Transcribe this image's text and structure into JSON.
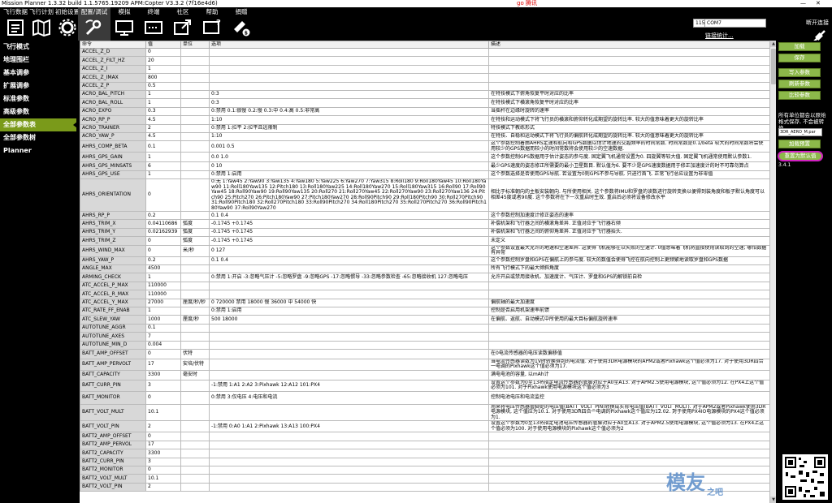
{
  "title": "Mission Planner 1.3.32 build 1.1.5765.19209 APM:Copter V3.3.2 (7f16e4d6)",
  "titlebar_ad": "go 腾讯",
  "window_minimize": "—",
  "window_close": "✕",
  "menu": [
    {
      "label": "飞行数据",
      "icon": "flight-data-icon"
    },
    {
      "label": "飞行计划",
      "icon": "flight-plan-icon"
    },
    {
      "label": "初始设置",
      "icon": "initial-setup-icon"
    },
    {
      "label": "配置/调试",
      "icon": "config-tuning-icon"
    },
    {
      "label": "模拟",
      "icon": "simulation-icon"
    },
    {
      "label": "终端",
      "icon": "terminal-icon"
    },
    {
      "label": "社区",
      "icon": "community-icon"
    },
    {
      "label": "帮助",
      "icon": "help-icon"
    },
    {
      "label": "捐赠",
      "icon": "donate-icon"
    }
  ],
  "connection": {
    "port": "COM7",
    "baud": "115200",
    "link_stats": "链接统计...",
    "disconnect": "断开连接"
  },
  "sidebar": [
    "飞行模式",
    "地理围栏",
    "基本调参",
    "扩展调参",
    "标准参数",
    "高级参数",
    "全部参数表",
    "全部参数树",
    "Planner"
  ],
  "sidebar_active": 6,
  "columns": [
    "命令",
    "值",
    "单位",
    "选项",
    "描述"
  ],
  "rows": [
    {
      "n": "ACCEL_Z_D",
      "v": "0",
      "u": "",
      "o": "",
      "d": ""
    },
    {
      "n": "ACCEL_Z_FILT_HZ",
      "v": "20",
      "u": "",
      "o": "",
      "d": ""
    },
    {
      "n": "ACCEL_Z_I",
      "v": "1",
      "u": "",
      "o": "",
      "d": ""
    },
    {
      "n": "ACCEL_Z_IMAX",
      "v": "800",
      "u": "",
      "o": "",
      "d": ""
    },
    {
      "n": "ACCEL_Z_P",
      "v": "0.5",
      "u": "",
      "o": "",
      "d": ""
    },
    {
      "n": "ACRO_BAL_PITCH",
      "v": "1",
      "u": "",
      "o": "0:3",
      "d": "在特技模式下俯角恢复平时对应的比率"
    },
    {
      "n": "ACRO_BAL_ROLL",
      "v": "1",
      "u": "",
      "o": "0:3",
      "d": "在特技模式下横滚角恢复平时对应的比率"
    },
    {
      "n": "ACRO_EXPO",
      "v": "0.3",
      "u": "",
      "o": "0:禁用 0.1:很慢 0.2:慢 0.3:中 0.4:高 0.5:非常高",
      "d": "当摇杆在边缘时旋转的速率"
    },
    {
      "n": "ACRO_RP_P",
      "v": "4.5",
      "u": "",
      "o": "1:10",
      "d": "在特技和运动模式下将飞行员的横滚和俯仰转化成期望的旋转比率. 较大的值意味着更大的旋转比率"
    },
    {
      "n": "ACRO_TRAINER",
      "v": "2",
      "u": "",
      "o": "0:禁用 1:拉平 2:拉平且远限制",
      "d": "特技模式下教练形式"
    },
    {
      "n": "ACRO_YAW_P",
      "v": "4.5",
      "u": "",
      "o": "1:10",
      "d": "在特技、自稳和运动模式下将飞行员的偏航转化成期望的旋转比率. 较大的值意味着更大的旋转比率"
    },
    {
      "n": "AHRS_COMP_BETA",
      "v": "0.1",
      "u": "",
      "o": "0.001 0.5",
      "d": "这个参数控制着由AHRS定速和航向和GPS数据以估计地速的交越频率的时间常数. 时间常数是0.1/beta 较大的时间常数将会使用较少的GPS数据而较小的时间常数将会使用较少的空速数据."
    },
    {
      "n": "AHRS_GPS_GAIN",
      "v": "1",
      "u": "",
      "o": "0.0 1.0",
      "d": "这个参数控制GPS数据用于估计姿态的参与度. 固定翼飞机通常设置为0. 四旋翼等较大值. 固定翼飞机通常使用默认参数1."
    },
    {
      "n": "AHRS_GPS_MINSATS",
      "v": "6",
      "u": "",
      "o": "0 10",
      "d": "最少GPS速度的姿态修正所需要的最小卫星数目. 默认值为6. 要不少是GPS速度数据用于修正加速度计的时不可靠勿算点"
    },
    {
      "n": "AHRS_GPS_USE",
      "v": "1",
      "u": "",
      "o": "0:禁用 1:启用",
      "d": "这个参数选择是否使用GPS导航. 若设置为0则GPS不参与导航. 只进行首飞. 正常飞行总应设置为非零值"
    },
    {
      "n": "AHRS_ORIENTATION",
      "v": "0",
      "u": "",
      "o": "0:无 1:Yaw45 2:Yaw90 3:Yaw135 4:Yaw180 5:Yaw225 6:Yaw270 7:Yaw315 8:Roll180 9:Roll180Yaw45 10:Roll180Yaw90 11:Roll180Yaw135 12:Pitch180 13:Roll180Yaw225 14:Roll180Yaw270 15:Roll180Yaw315 16:Roll90 17:Roll90Yaw45 18:Roll90Yaw90 19:Roll90Yaw135 20:Roll270 21:Roll270Yaw45 22:Roll270Yaw90 23:Roll270Yaw136 24:Pitch90 25:Pitch270 26:Pitch180Yaw90 27:Pitch180Yaw270 28:Roll90Pitch90 29:Roll180Pitch90 30:Roll270Pitch90 31:Roll90Pitch180 32:Roll270Pitch180 33:Roll90Pitch270 34:Roll180Pitch270 35:Roll270Pitch270 36:Roll90Pitch180Yaw90 37:Roll90Yaw270",
      "d": "相比于标准朝向的主板安装朝向. 与所使用相关. 这个参数将IMU和罗盘的读数进行旋转变换以便得到装角度和板子默认角度可以相差45度或者90度. 这个参数将在下一次重启时生效. 重启后必须将设备修改水平"
    },
    {
      "n": "AHRS_RP_P",
      "v": "0.2",
      "u": "",
      "o": "0.1 0.4",
      "d": "这个参数控制加速度计修正姿态的速率"
    },
    {
      "n": "AHRS_TRIM_X",
      "v": "0.04110686",
      "u": "弧度",
      "o": "-0.1745 +0.1745",
      "d": "补偿机架和飞行器之间的横滚角差异. 正值对应于飞行器右倾"
    },
    {
      "n": "AHRS_TRIM_Y",
      "v": "0.02162939",
      "u": "弧度",
      "o": "-0.1745 +0.1745",
      "d": "补偿机架和飞行器之间的俯仰角差异. 正值对应于飞行器抬头."
    },
    {
      "n": "AHRS_TRIM_Z",
      "v": "0",
      "u": "弧度",
      "o": "-0.1745 +0.1745",
      "d": "未定义"
    },
    {
      "n": "AHRS_WIND_MAX",
      "v": "0",
      "u": "米/秒",
      "o": "0 127",
      "d": "这个参数设置最大允许的地速和空速差异. 这使得飞机能够在以失败的空速计. 0值意味着飞机将直接使用读取到的空速; 哪怕数据有异常"
    },
    {
      "n": "AHRS_YAW_P",
      "v": "0.2",
      "u": "",
      "o": "0.1 0.4",
      "d": "这个参数控制罗盘和GPS在偏航上的参与度. 较大的数值会使得飞控在航向控制上更频繁地读取罗盘和GPS数据"
    },
    {
      "n": "ANGLE_MAX",
      "v": "4500",
      "u": "",
      "o": "",
      "d": "所有飞行模式下的最大倾斜角度"
    },
    {
      "n": "ARMING_CHECK",
      "v": "1",
      "u": "",
      "o": "0:禁用 1:开启 -3:忽略气压计 -5:忽略罗盘 -9:忽略GPS -17:忽略惯导 -33:忽略参数检查 -65:忽略接收机 127:忽略电压",
      "d": "允许开启或禁用接收机、加速度计、气压计、罗盘和GPS的解锁前自检"
    },
    {
      "n": "ATC_ACCEL_P_MAX",
      "v": "110000",
      "u": "",
      "o": "",
      "d": ""
    },
    {
      "n": "ATC_ACCEL_R_MAX",
      "v": "110000",
      "u": "",
      "o": "",
      "d": ""
    },
    {
      "n": "ATC_ACCEL_Y_MAX",
      "v": "27000",
      "u": "厘度/秒/秒",
      "o": "0 720000 禁用 18000 慢 36000 中 54000 快",
      "d": "偏航轴的最大加速度"
    },
    {
      "n": "ATC_RATE_FF_ENAB",
      "v": "1",
      "u": "",
      "o": "0:禁用 1:启用",
      "d": "控制是否启用机架速率前馈"
    },
    {
      "n": "ATC_SLEW_YAW",
      "v": "1000",
      "u": "厘度/秒",
      "o": "500 18000",
      "d": "在偏航、返航、自动模式中所使用的最大目标偏航旋转速率"
    },
    {
      "n": "AUTOTUNE_AGGR",
      "v": "0.1",
      "u": "",
      "o": "",
      "d": ""
    },
    {
      "n": "AUTOTUNE_AXES",
      "v": "7",
      "u": "",
      "o": "",
      "d": ""
    },
    {
      "n": "AUTOTUNE_MIN_D",
      "v": "0.004",
      "u": "",
      "o": "",
      "d": ""
    },
    {
      "n": "BATT_AMP_OFFSET",
      "v": "0",
      "u": "伏特",
      "o": "",
      "d": "在0电流传感器的电压读数偏移值"
    },
    {
      "n": "BATT_AMP_PERVOLT",
      "v": "17",
      "u": "安培/伏特",
      "o": "",
      "d": "当电流传感器读数为1V时转换得到的电流值. 对于使用3DR电源模块的APM2或者Pixhawk这个值必须为17. 对于使用3DR四合一电调的Pixhawk这个值必须为17."
    },
    {
      "n": "BATT_CAPACITY",
      "v": "3300",
      "u": "毫安时",
      "o": "",
      "d": "满电电池的容量, 以mAh计"
    },
    {
      "n": "BATT_CURR_PIN",
      "v": "3",
      "u": "",
      "o": "-1:禁用 1:A1 2:A2 3:Pixhawk 12:A12 101:PX4",
      "d": "设置这个参数为0至13将指定电流传感器的管脚对应于A0至A13. 对于APM2.5使用电源模块, 这个值必须为12. 在PX4上这个值必须为101. 对于Pixhawk使用电源模块这个值必须为3"
    },
    {
      "n": "BATT_MONITOR",
      "v": "0",
      "u": "",
      "o": "0:禁用 3:仅电压 4:电压和电流",
      "d": "控制电池电压和电流监控"
    },
    {
      "n": "BATT_VOLT_MULT",
      "v": "10.1",
      "u": "",
      "o": "",
      "d": "用来将电压传感器管脚处的电压值(BATT_VOLT_PIN)转换成实际电压值(BATT_VOLT_MULT). 对于APM2或者Pixhawk使用3DR电源模块, 这个值应为10.1. 对于使用3DR四合一电调的Pixhawk这个值应为12.02. 对于使用PX4IO电源模块的PX4这个值必须为1."
    },
    {
      "n": "BATT_VOLT_PIN",
      "v": "2",
      "u": "",
      "o": "-1:禁用 0:A0 1:A1 2:Pixhawk 13:A13 100:PX4",
      "d": "设置这个参数为0至13将指定电池电压传感器的管脚对应于A0至A13. 对于APM2.5使用电源模块, 这个值必须为13. 在PX4上这个值必须为100. 对于使用电源模块的Pixhawk这个值必须为2"
    },
    {
      "n": "BATT2_AMP_OFFSET",
      "v": "0",
      "u": "",
      "o": "",
      "d": ""
    },
    {
      "n": "BATT2_AMP_PERVOL",
      "v": "17",
      "u": "",
      "o": "",
      "d": ""
    },
    {
      "n": "BATT2_CAPACITY",
      "v": "3300",
      "u": "",
      "o": "",
      "d": ""
    },
    {
      "n": "BATT2_CURR_PIN",
      "v": "3",
      "u": "",
      "o": "",
      "d": ""
    },
    {
      "n": "BATT2_MONITOR",
      "v": "0",
      "u": "",
      "o": "",
      "d": ""
    },
    {
      "n": "BATT2_VOLT_MULT",
      "v": "10.1",
      "u": "",
      "o": "",
      "d": ""
    },
    {
      "n": "BATT2_VOLT_PIN",
      "v": "2",
      "u": "",
      "o": "",
      "d": ""
    }
  ],
  "right_panel": {
    "load": "加载",
    "save": "保存",
    "write": "写入参数",
    "refresh": "刷新参数",
    "compare": "比较参数",
    "note": "所有单位都会以原始格式保存, 不会被转换",
    "select_value": "3DR_AERO_M.par",
    "load_preset": "加载预置",
    "reset_default": "重置为默认值",
    "status": "3.4.1"
  },
  "watermark": "模友",
  "watermark_sub": "之吧",
  "colors": {
    "accent_green": "#8cb84a",
    "sidebar_active": "#7a9a1a",
    "highlight_circle": "#d020c0",
    "selected_cell": "#3366cc"
  }
}
